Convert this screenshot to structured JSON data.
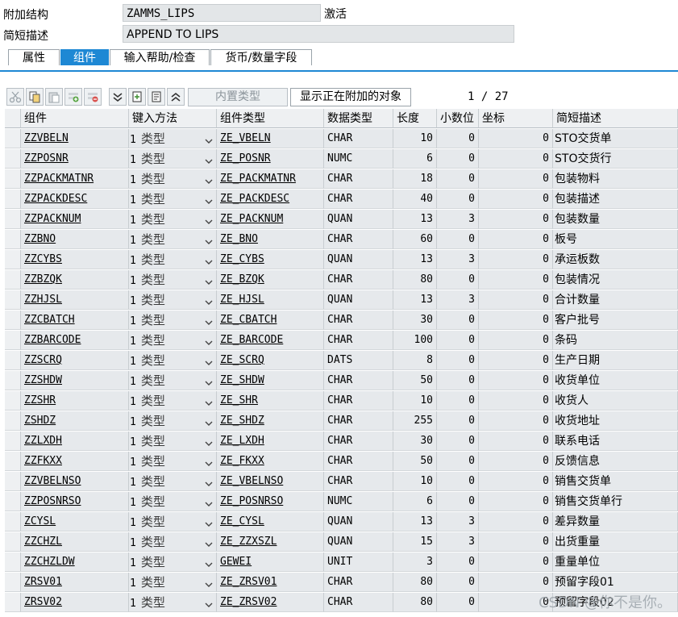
{
  "header": {
    "append_label": "附加结构",
    "append_value": "ZAMMS_LIPS",
    "status": "激活",
    "desc_label": "简短描述",
    "desc_value": "APPEND TO LIPS"
  },
  "tabs": [
    {
      "label": "属性",
      "active": false
    },
    {
      "label": "组件",
      "active": true
    },
    {
      "label": "输入帮助/检查",
      "active": false
    },
    {
      "label": "货币/数量字段",
      "active": false
    }
  ],
  "toolbar": {
    "icons": [
      "cut-icon",
      "copy-icon",
      "paste-icon",
      "insert-row-icon",
      "delete-row-icon",
      "collapse-icon",
      "new-entry-icon",
      "detail-icon",
      "expand-icon"
    ],
    "builtin_type_label": "内置类型",
    "show_appending_label": "显示正在附加的对象",
    "page": "1 / 27"
  },
  "columns": [
    "组件",
    "键入方法",
    "组件类型",
    "数据类型",
    "长度",
    "小数位",
    "坐标",
    "简短描述"
  ],
  "rows": [
    {
      "name": "ZZVBELN",
      "m1": "1",
      "m2": "类型",
      "ctype": "ZE_VBELN",
      "dtype": "CHAR",
      "len": "10",
      "dec": "0",
      "coord": "0",
      "desc": "STO交货单"
    },
    {
      "name": "ZZPOSNR",
      "m1": "1",
      "m2": "类型",
      "ctype": "ZE_POSNR",
      "dtype": "NUMC",
      "len": "6",
      "dec": "0",
      "coord": "0",
      "desc": "STO交货行"
    },
    {
      "name": "ZZPACKMATNR",
      "m1": "1",
      "m2": "类型",
      "ctype": "ZE_PACKMATNR",
      "dtype": "CHAR",
      "len": "18",
      "dec": "0",
      "coord": "0",
      "desc": "包装物料"
    },
    {
      "name": "ZZPACKDESC",
      "m1": "1",
      "m2": "类型",
      "ctype": "ZE_PACKDESC",
      "dtype": "CHAR",
      "len": "40",
      "dec": "0",
      "coord": "0",
      "desc": "包装描述"
    },
    {
      "name": "ZZPACKNUM",
      "m1": "1",
      "m2": "类型",
      "ctype": "ZE_PACKNUM",
      "dtype": "QUAN",
      "len": "13",
      "dec": "3",
      "coord": "0",
      "desc": "包装数量"
    },
    {
      "name": "ZZBNO",
      "m1": "1",
      "m2": "类型",
      "ctype": "ZE_BNO",
      "dtype": "CHAR",
      "len": "60",
      "dec": "0",
      "coord": "0",
      "desc": "板号"
    },
    {
      "name": "ZZCYBS",
      "m1": "1",
      "m2": "类型",
      "ctype": "ZE_CYBS",
      "dtype": "QUAN",
      "len": "13",
      "dec": "3",
      "coord": "0",
      "desc": "承运板数"
    },
    {
      "name": "ZZBZQK",
      "m1": "1",
      "m2": "类型",
      "ctype": "ZE_BZQK",
      "dtype": "CHAR",
      "len": "80",
      "dec": "0",
      "coord": "0",
      "desc": "包装情况"
    },
    {
      "name": "ZZHJSL",
      "m1": "1",
      "m2": "类型",
      "ctype": "ZE_HJSL",
      "dtype": "QUAN",
      "len": "13",
      "dec": "3",
      "coord": "0",
      "desc": "合计数量"
    },
    {
      "name": "ZZCBATCH",
      "m1": "1",
      "m2": "类型",
      "ctype": "ZE_CBATCH",
      "dtype": "CHAR",
      "len": "30",
      "dec": "0",
      "coord": "0",
      "desc": "客户批号"
    },
    {
      "name": "ZZBARCODE",
      "m1": "1",
      "m2": "类型",
      "ctype": "ZE_BARCODE",
      "dtype": "CHAR",
      "len": "100",
      "dec": "0",
      "coord": "0",
      "desc": "条码"
    },
    {
      "name": "ZZSCRQ",
      "m1": "1",
      "m2": "类型",
      "ctype": "ZE_SCRQ",
      "dtype": "DATS",
      "len": "8",
      "dec": "0",
      "coord": "0",
      "desc": "生产日期"
    },
    {
      "name": "ZZSHDW",
      "m1": "1",
      "m2": "类型",
      "ctype": "ZE_SHDW",
      "dtype": "CHAR",
      "len": "50",
      "dec": "0",
      "coord": "0",
      "desc": "收货单位"
    },
    {
      "name": "ZZSHR",
      "m1": "1",
      "m2": "类型",
      "ctype": "ZE_SHR",
      "dtype": "CHAR",
      "len": "10",
      "dec": "0",
      "coord": "0",
      "desc": "收货人"
    },
    {
      "name": "ZSHDZ",
      "m1": "1",
      "m2": "类型",
      "ctype": "ZE_SHDZ",
      "dtype": "CHAR",
      "len": "255",
      "dec": "0",
      "coord": "0",
      "desc": "收货地址"
    },
    {
      "name": "ZZLXDH",
      "m1": "1",
      "m2": "类型",
      "ctype": "ZE_LXDH",
      "dtype": "CHAR",
      "len": "30",
      "dec": "0",
      "coord": "0",
      "desc": "联系电话"
    },
    {
      "name": "ZZFKXX",
      "m1": "1",
      "m2": "类型",
      "ctype": "ZE_FKXX",
      "dtype": "CHAR",
      "len": "50",
      "dec": "0",
      "coord": "0",
      "desc": "反馈信息"
    },
    {
      "name": "ZZVBELNSO",
      "m1": "1",
      "m2": "类型",
      "ctype": "ZE_VBELNSO",
      "dtype": "CHAR",
      "len": "10",
      "dec": "0",
      "coord": "0",
      "desc": "销售交货单"
    },
    {
      "name": "ZZPOSNRSO",
      "m1": "1",
      "m2": "类型",
      "ctype": "ZE_POSNRSO",
      "dtype": "NUMC",
      "len": "6",
      "dec": "0",
      "coord": "0",
      "desc": "销售交货单行"
    },
    {
      "name": "ZCYSL",
      "m1": "1",
      "m2": "类型",
      "ctype": "ZE_CYSL",
      "dtype": "QUAN",
      "len": "13",
      "dec": "3",
      "coord": "0",
      "desc": "差异数量"
    },
    {
      "name": "ZZCHZL",
      "m1": "1",
      "m2": "类型",
      "ctype": "ZE_ZZXSZL",
      "dtype": "QUAN",
      "len": "15",
      "dec": "3",
      "coord": "0",
      "desc": "出货重量"
    },
    {
      "name": "ZZCHZLDW",
      "m1": "1",
      "m2": "类型",
      "ctype": "GEWEI",
      "dtype": "UNIT",
      "len": "3",
      "dec": "0",
      "coord": "0",
      "desc": "重量单位"
    },
    {
      "name": "ZRSV01",
      "m1": "1",
      "m2": "类型",
      "ctype": "ZE_ZRSV01",
      "dtype": "CHAR",
      "len": "80",
      "dec": "0",
      "coord": "0",
      "desc": "预留字段01"
    },
    {
      "name": "ZRSV02",
      "m1": "1",
      "m2": "类型",
      "ctype": "ZE_ZRSV02",
      "dtype": "CHAR",
      "len": "80",
      "dec": "0",
      "coord": "0",
      "desc": "预留字段02"
    }
  ],
  "watermark": "CSDN @你不是你。"
}
